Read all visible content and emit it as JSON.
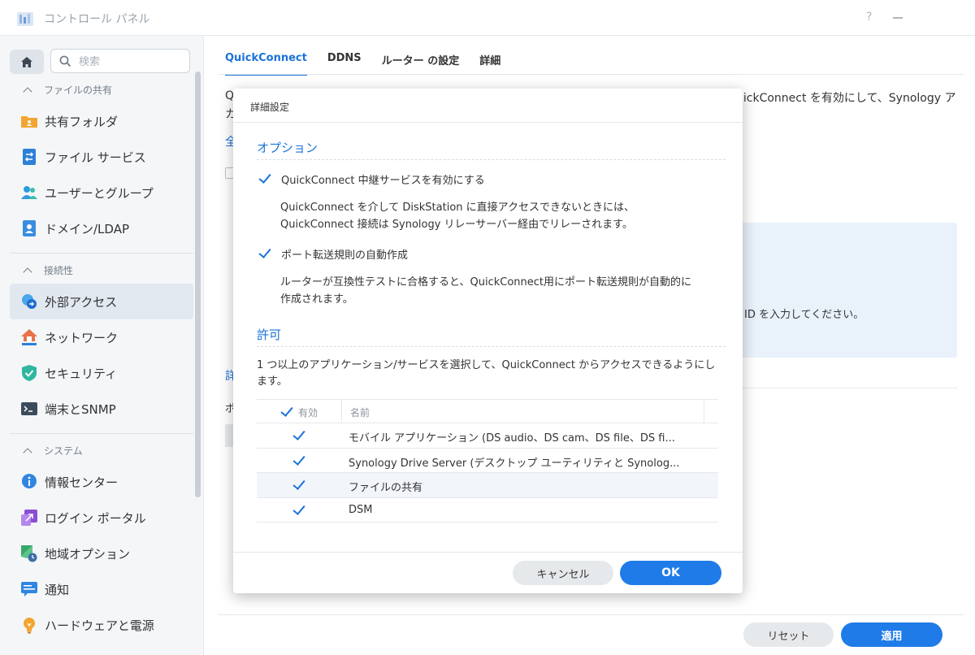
{
  "window": {
    "title": "コントロール パネル",
    "help": "?"
  },
  "sidebar": {
    "search_placeholder": "検索",
    "sections": [
      {
        "label": "ファイルの共有",
        "items": [
          {
            "label": "共有フォルダ",
            "icon": "shared-folder-icon"
          },
          {
            "label": "ファイル サービス",
            "icon": "file-services-icon"
          },
          {
            "label": "ユーザーとグループ",
            "icon": "users-groups-icon"
          },
          {
            "label": "ドメイン/LDAP",
            "icon": "domain-ldap-icon"
          }
        ]
      },
      {
        "label": "接続性",
        "items": [
          {
            "label": "外部アクセス",
            "icon": "external-access-icon",
            "active": true
          },
          {
            "label": "ネットワーク",
            "icon": "network-icon"
          },
          {
            "label": "セキュリティ",
            "icon": "security-icon"
          },
          {
            "label": "端末とSNMP",
            "icon": "terminal-snmp-icon"
          }
        ]
      },
      {
        "label": "システム",
        "items": [
          {
            "label": "情報センター",
            "icon": "info-center-icon"
          },
          {
            "label": "ログイン ポータル",
            "icon": "login-portal-icon"
          },
          {
            "label": "地域オプション",
            "icon": "regional-options-icon"
          },
          {
            "label": "通知",
            "icon": "notification-icon"
          },
          {
            "label": "ハードウェアと電源",
            "icon": "hardware-power-icon"
          }
        ]
      }
    ]
  },
  "main": {
    "tabs": [
      "QuickConnect",
      "DDNS",
      "ルーター の設定",
      "詳細"
    ],
    "active_tab": "QuickConnect",
    "bg_line1_left": "Q",
    "bg_line1_right": "uickConnect を有効にして、Synology ア",
    "bg_line2_left": "カ",
    "bg_section1": "全",
    "bg_info_text": "ID を入力してください。",
    "bg_section2": "詳",
    "bg_label": "ポ",
    "reset_label": "リセット",
    "apply_label": "適用"
  },
  "modal": {
    "title": "詳細設定",
    "options_header": "オプション",
    "option1": {
      "label": "QuickConnect 中継サービスを有効にする",
      "checked": true,
      "desc_line1": "QuickConnect を介して DiskStation に直接アクセスできないときには、",
      "desc_line2": "QuickConnect 接続は Synology リレーサーバー経由でリレーされます。"
    },
    "option2": {
      "label": "ポート転送規則の自動作成",
      "checked": true,
      "desc_line1": "ルーターが互換性テストに合格すると、QuickConnect用にポート転送規則が自動的に",
      "desc_line2": "作成されます。"
    },
    "permission_header": "許可",
    "permission_desc": "1 つ以上のアプリケーション/サービスを選択して、QuickConnect からアクセスできるようにします。",
    "table": {
      "col_enabled": "有効",
      "col_name": "名前",
      "rows": [
        {
          "name": "モバイル アプリケーション (DS audio、DS cam、DS file、DS fi...",
          "enabled": true
        },
        {
          "name": "Synology Drive Server (デスクトップ ユーティリティと Synolog...",
          "enabled": true
        },
        {
          "name": "ファイルの共有",
          "enabled": true
        },
        {
          "name": "DSM",
          "enabled": true
        }
      ]
    },
    "cancel_label": "キャンセル",
    "ok_label": "OK"
  },
  "colors": {
    "accent": "#1a73d9",
    "primary_button": "#1f7be8",
    "sidebar_bg": "#f4f6f8",
    "active_item_bg": "#e2e8f0"
  }
}
